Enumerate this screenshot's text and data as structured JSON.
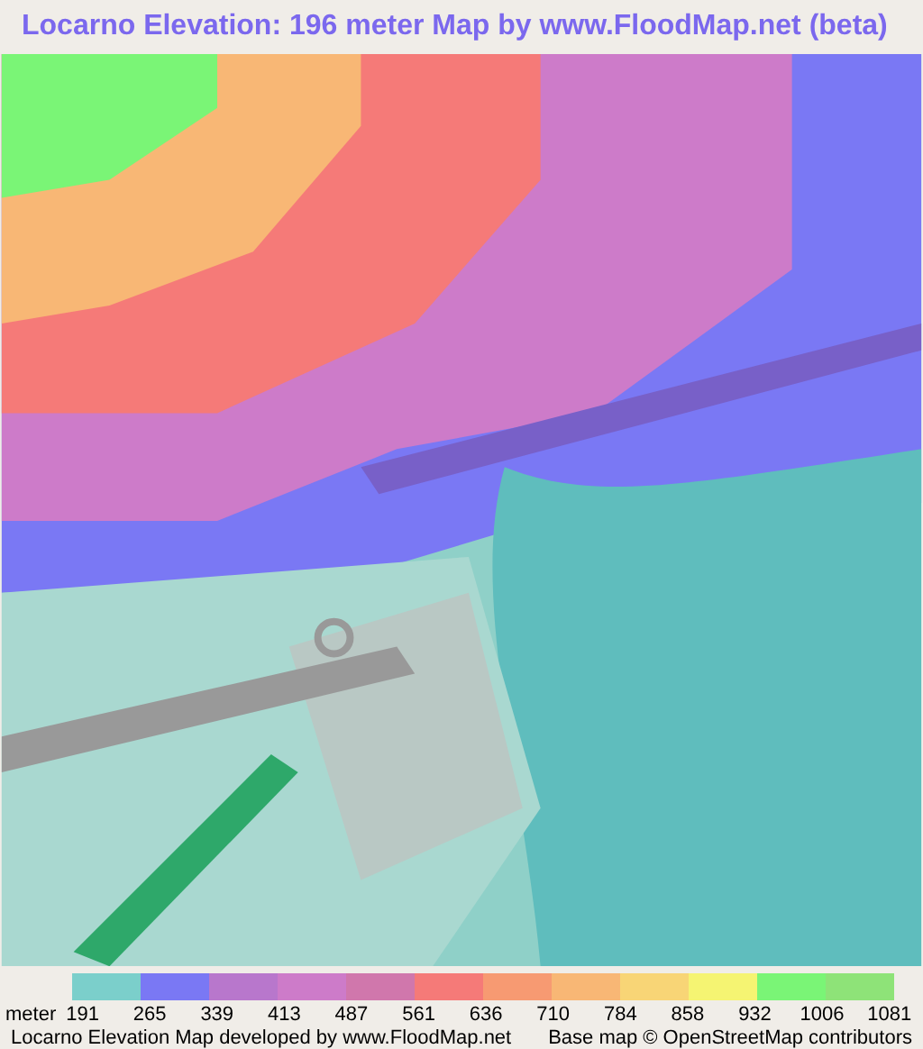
{
  "title": "Locarno Elevation: 196 meter Map by www.FloodMap.net (beta)",
  "legend": {
    "unit": "meter",
    "swatches": [
      {
        "color": "#7bcfcb"
      },
      {
        "color": "#7a78f4"
      },
      {
        "color": "#b877cc"
      },
      {
        "color": "#cd7bc9"
      },
      {
        "color": "#d077ac"
      },
      {
        "color": "#f57a78"
      },
      {
        "color": "#f79a72"
      },
      {
        "color": "#f8b775"
      },
      {
        "color": "#f8d576"
      },
      {
        "color": "#f5f472"
      },
      {
        "color": "#7af576"
      },
      {
        "color": "#8ee378"
      }
    ],
    "labels": [
      "191",
      "265",
      "339",
      "413",
      "487",
      "561",
      "636",
      "710",
      "784",
      "858",
      "932",
      "1006",
      "1081"
    ]
  },
  "footer": {
    "left": "Locarno Elevation Map developed by www.FloodMap.net",
    "right": "Base map © OpenStreetMap contributors"
  }
}
